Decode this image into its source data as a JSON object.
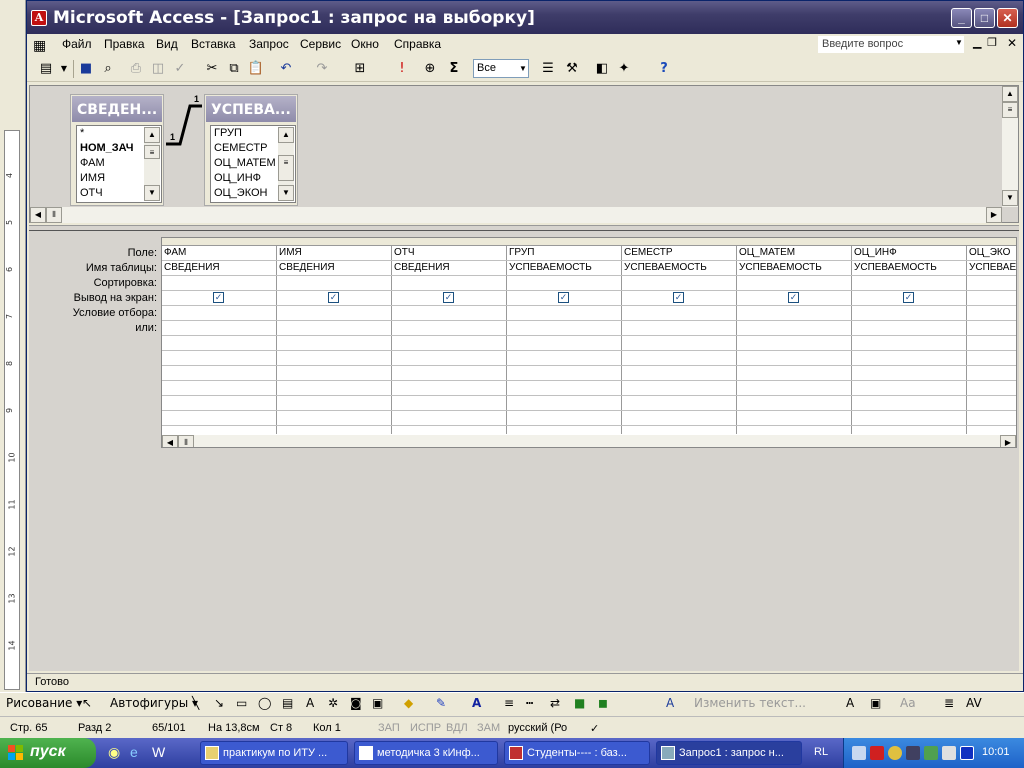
{
  "word": {
    "ruler_ticks": [
      "4",
      "5",
      "6",
      "7",
      "8",
      "9",
      "10",
      "11",
      "12",
      "13",
      "14"
    ]
  },
  "window": {
    "title": "Microsoft Access - [Запрос1 : запрос на выборку]",
    "min": "_",
    "max": "□",
    "close": "✕"
  },
  "menu": {
    "items": [
      "Файл",
      "Правка",
      "Вид",
      "Вставка",
      "Запрос",
      "Сервис",
      "Окно",
      "Справка"
    ],
    "ask_placeholder": "Введите вопрос"
  },
  "toolbar": {
    "top_values": "Все",
    "sigma": "Σ",
    "help": "?"
  },
  "tables": [
    {
      "name": "СВЕДЕН...",
      "fields": [
        "*",
        "НОМ_ЗАЧ",
        "ФАМ",
        "ИМЯ",
        "ОТЧ"
      ],
      "key_field": "НОМ_ЗАЧ"
    },
    {
      "name": "УСПЕВА...",
      "fields": [
        "ГРУП",
        "СЕМЕСТР",
        "ОЦ_МАТЕМ",
        "ОЦ_ИНФ",
        "ОЦ_ЭКОН"
      ]
    }
  ],
  "relation": {
    "left_label": "1",
    "right_label": "1"
  },
  "grid": {
    "row_labels": [
      "Поле:",
      "Имя таблицы:",
      "Сортировка:",
      "Вывод на экран:",
      "Условие отбора:",
      "или:"
    ],
    "columns": [
      {
        "field": "ФАМ",
        "table": "СВЕДЕНИЯ",
        "show": true
      },
      {
        "field": "ИМЯ",
        "table": "СВЕДЕНИЯ",
        "show": true
      },
      {
        "field": "ОТЧ",
        "table": "СВЕДЕНИЯ",
        "show": true
      },
      {
        "field": "ГРУП",
        "table": "УСПЕВАЕМОСТЬ",
        "show": true
      },
      {
        "field": "СЕМЕСТР",
        "table": "УСПЕВАЕМОСТЬ",
        "show": true
      },
      {
        "field": "ОЦ_МАТЕМ",
        "table": "УСПЕВАЕМОСТЬ",
        "show": true
      },
      {
        "field": "ОЦ_ИНФ",
        "table": "УСПЕВАЕМОСТЬ",
        "show": true
      },
      {
        "field": "ОЦ_ЭКО",
        "table": "УСПЕВАЕ",
        "show": false
      }
    ]
  },
  "status": "Готово",
  "drawbar": {
    "draw": "Рисование ▾",
    "autoshapes": "Автофигуры ▾",
    "change_text": "Изменить текст..."
  },
  "wordstatus": {
    "page": "Стр.  65",
    "section": "Разд  2",
    "pages": "65/101",
    "pos": "На 13,8см",
    "line": "Ст  8",
    "col": "Кол  1",
    "rec": "ЗАП",
    "track": "ИСПР",
    "ext": "ВДЛ",
    "ovr": "ЗАМ",
    "lang": "русский (Ро"
  },
  "taskbar": {
    "start": "пуск",
    "tasks": [
      "практикум по ИТУ ...",
      "методичка 3 кИнф...",
      "Студенты---- : баз...",
      "Запрос1 : запрос н..."
    ],
    "lang": "RL",
    "clock": "10:01"
  }
}
